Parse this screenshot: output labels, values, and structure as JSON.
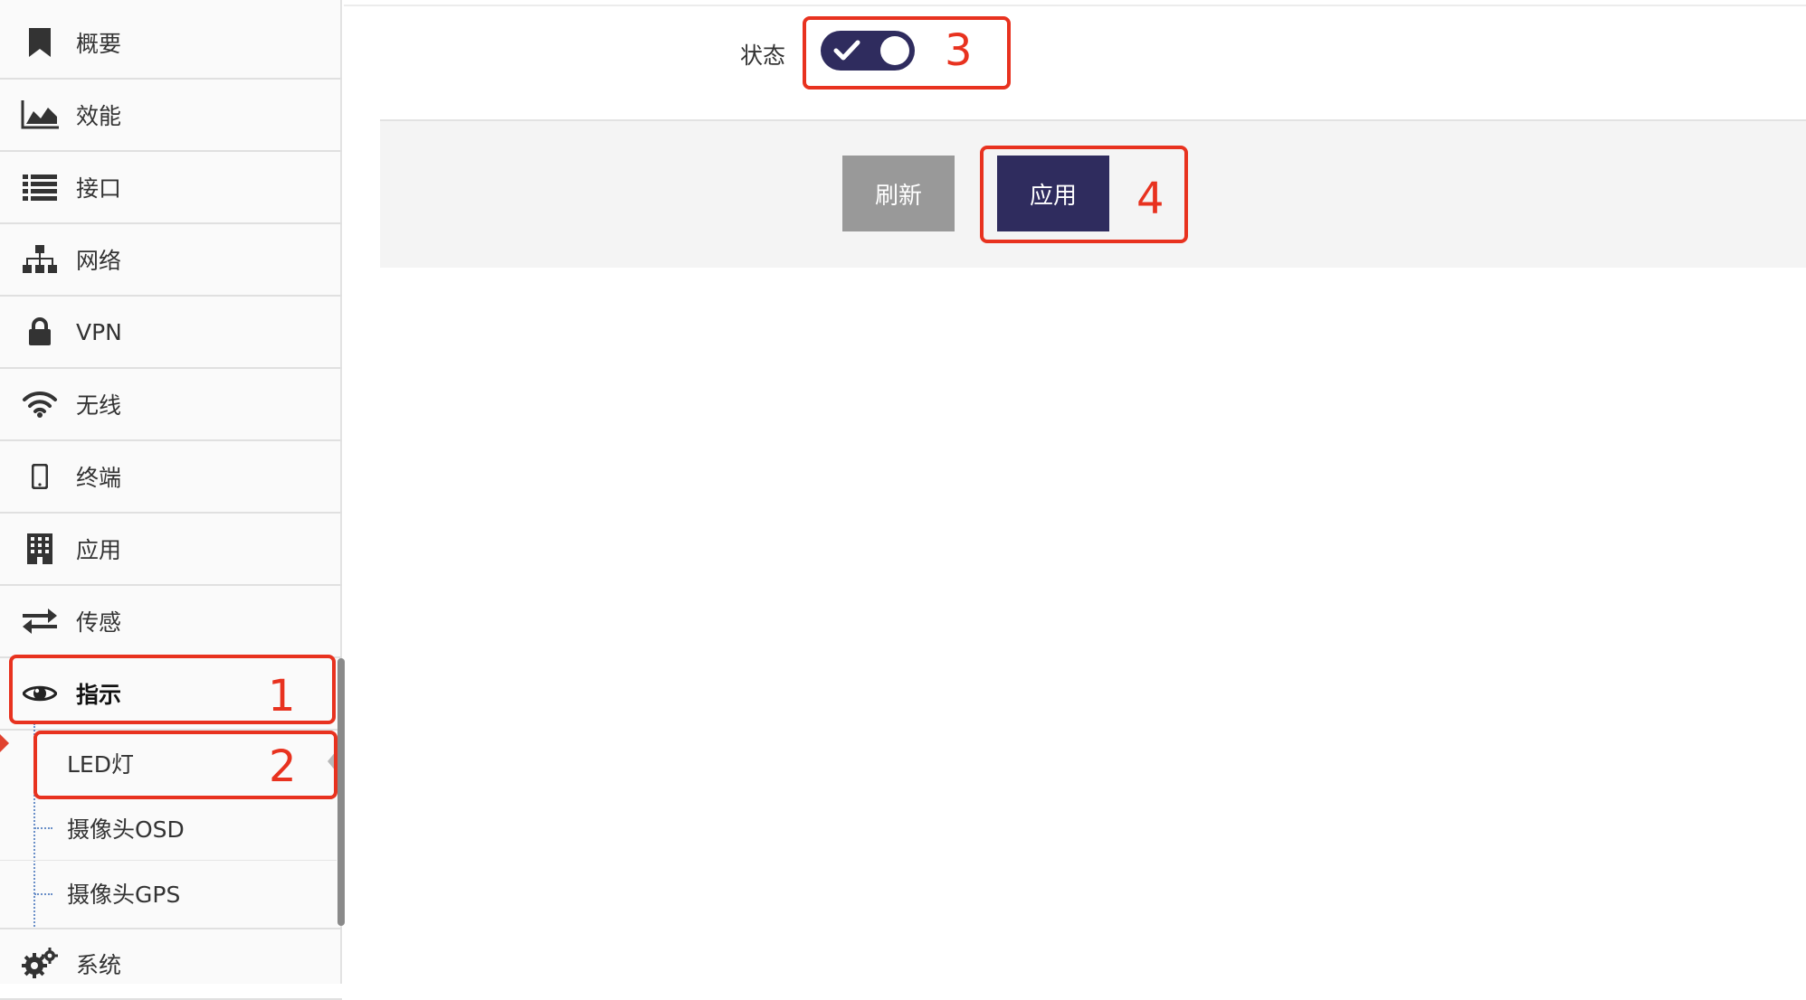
{
  "sidebar": {
    "items": [
      {
        "label": "概要",
        "icon": "bookmark-icon"
      },
      {
        "label": "效能",
        "icon": "area-chart-icon"
      },
      {
        "label": "接口",
        "icon": "list-icon"
      },
      {
        "label": "网络",
        "icon": "sitemap-icon"
      },
      {
        "label": "VPN",
        "icon": "lock-icon"
      },
      {
        "label": "无线",
        "icon": "wifi-icon"
      },
      {
        "label": "终端",
        "icon": "mobile-icon"
      },
      {
        "label": "应用",
        "icon": "building-icon"
      },
      {
        "label": "传感",
        "icon": "exchange-icon"
      },
      {
        "label": "指示",
        "icon": "eye-icon",
        "active": true
      },
      {
        "label": "系统",
        "icon": "cogs-icon"
      }
    ],
    "sub_items": [
      {
        "label": "LED灯",
        "active": true
      },
      {
        "label": "摄像头OSD"
      },
      {
        "label": "摄像头GPS"
      }
    ]
  },
  "main": {
    "status_label": "状态",
    "status_toggle_on": true,
    "refresh_label": "刷新",
    "apply_label": "应用"
  },
  "annotations": [
    "1",
    "2",
    "3",
    "4"
  ],
  "colors": {
    "accent": "#2f2c5e",
    "refresh_button": "#999999",
    "annotation": "#e8321f"
  }
}
